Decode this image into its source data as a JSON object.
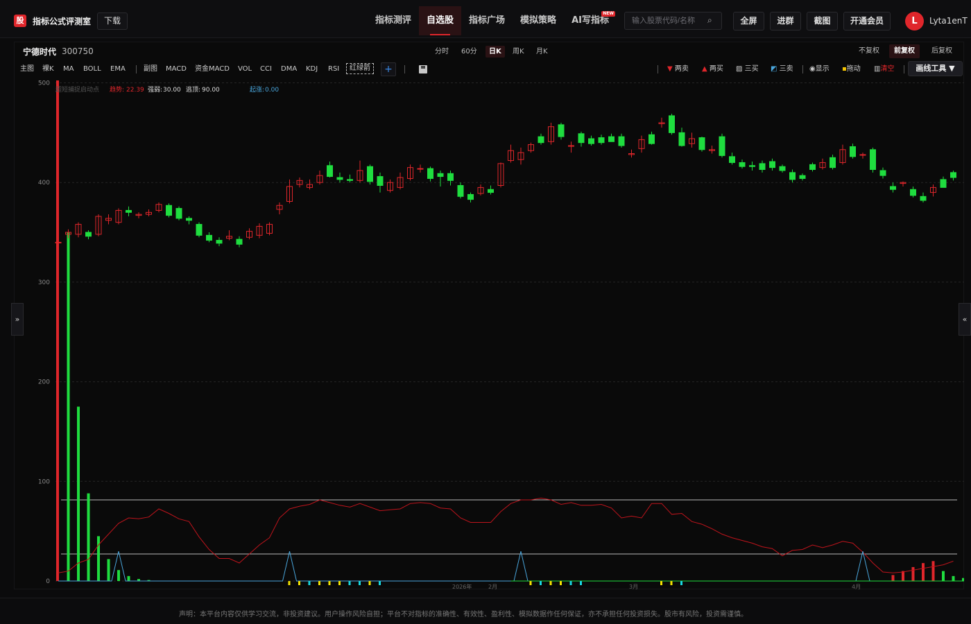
{
  "app": {
    "logo_char": "股",
    "title": "指标公式评测室",
    "download_label": "下载"
  },
  "nav": {
    "items": [
      {
        "label": "指标测评",
        "active": false
      },
      {
        "label": "自选股",
        "active": true
      },
      {
        "label": "指标广场",
        "active": false
      },
      {
        "label": "模拟策略",
        "active": false
      },
      {
        "label": "AI写指标",
        "active": false,
        "badge": "NEW"
      }
    ]
  },
  "search": {
    "placeholder": "输入股票代码/名称",
    "icon": "search-icon"
  },
  "toolbar_right": {
    "fullscreen": "全屏",
    "join_group": "进群",
    "screenshot": "截图",
    "membership": "开通会员"
  },
  "user": {
    "avatar_letter": "L",
    "name": "Lyta1enT"
  },
  "stock": {
    "name": "宁德时代",
    "code": "300750"
  },
  "periods": [
    "分时",
    "60分",
    "日K",
    "周K",
    "月K"
  ],
  "active_period": "日K",
  "adjust": [
    "不复权",
    "前复权",
    "后复权"
  ],
  "active_adjust": "前复权",
  "indicators_main": [
    "主图",
    "裸K",
    "MA",
    "BOLL",
    "EMA"
  ],
  "indicators_sub": [
    "副图",
    "MACD",
    "资金MACD",
    "VOL",
    "CCI",
    "DMA",
    "KDJ",
    "RSI"
  ],
  "indicator_active": "红绿箭",
  "tools": {
    "two_sell": "两卖",
    "two_buy": "两买",
    "three_buy": "三买",
    "three_sell": "三卖",
    "show": "显示",
    "drag": "拖动",
    "clear": "清空",
    "draw_tools": "画线工具 ▼"
  },
  "colors": {
    "up": "#e0262b",
    "down": "#1fdd3f",
    "accent": "#e0262b",
    "blue_line": "#4aa6dc",
    "yellow": "#f4e300",
    "cyan": "#18d8e0"
  },
  "overlay_legend": {
    "name": "超短捕捉启动点",
    "trend_label": "趋势:",
    "trend_value": "22.39",
    "weak_label": "强弱:",
    "weak_value": "30.00",
    "top_label": "逃顶:",
    "top_value": "90.00",
    "rise_label": "起涨:",
    "rise_value": "0.00"
  },
  "x_axis_labels": [
    "2026年",
    "2月",
    "3月",
    "4月"
  ],
  "footer_text": "声明：本平台内容仅供学习交流，非投资建议。用户操作风险自担；平台不对指标的准确性、有效性、盈利性、模拟数据作任何保证，亦不承担任何投资损失。股市有风险，投资需谨慎。",
  "chart_data": {
    "type": "candlestick",
    "y_ticks": [
      0,
      100,
      200,
      300,
      400,
      500
    ],
    "ylim": [
      0,
      500
    ],
    "candles": [
      [
        340,
        340,
        338,
        342
      ],
      [
        348,
        350,
        344,
        353
      ],
      [
        348,
        358,
        345,
        360
      ],
      [
        350,
        346,
        343,
        352
      ],
      [
        348,
        366,
        346,
        368
      ],
      [
        362,
        364,
        358,
        368
      ],
      [
        360,
        372,
        358,
        374
      ],
      [
        372,
        370,
        366,
        376
      ],
      [
        367,
        368,
        364,
        370
      ],
      [
        368,
        370,
        366,
        373
      ],
      [
        372,
        378,
        370,
        380
      ],
      [
        377,
        367,
        365,
        379
      ],
      [
        374,
        364,
        362,
        376
      ],
      [
        364,
        362,
        358,
        366
      ],
      [
        358,
        347,
        345,
        360
      ],
      [
        347,
        342,
        340,
        350
      ],
      [
        342,
        339,
        336,
        345
      ],
      [
        344,
        346,
        342,
        352
      ],
      [
        343,
        338,
        335,
        346
      ],
      [
        345,
        351,
        343,
        354
      ],
      [
        347,
        356,
        344,
        359
      ],
      [
        349,
        358,
        347,
        360
      ],
      [
        373,
        377,
        368,
        380
      ],
      [
        381,
        396,
        379,
        403
      ],
      [
        398,
        402,
        395,
        405
      ],
      [
        395,
        398,
        393,
        403
      ],
      [
        400,
        407,
        398,
        412
      ],
      [
        417,
        406,
        405,
        421
      ],
      [
        405,
        403,
        400,
        410
      ],
      [
        403,
        402,
        400,
        408
      ],
      [
        402,
        412,
        400,
        422
      ],
      [
        416,
        401,
        398,
        418
      ],
      [
        406,
        397,
        390,
        410
      ],
      [
        392,
        400,
        390,
        403
      ],
      [
        395,
        405,
        393,
        410
      ],
      [
        404,
        415,
        402,
        418
      ],
      [
        414,
        414,
        410,
        418
      ],
      [
        414,
        404,
        401,
        416
      ],
      [
        409,
        406,
        396,
        412
      ],
      [
        409,
        402,
        397,
        412
      ],
      [
        397,
        386,
        384,
        400
      ],
      [
        388,
        383,
        380,
        390
      ],
      [
        389,
        395,
        387,
        398
      ],
      [
        393,
        390,
        388,
        397
      ],
      [
        397,
        419,
        395,
        420
      ],
      [
        422,
        432,
        420,
        438
      ],
      [
        423,
        430,
        418,
        435
      ],
      [
        432,
        438,
        430,
        440
      ],
      [
        446,
        440,
        438,
        449
      ],
      [
        441,
        456,
        438,
        460
      ],
      [
        458,
        446,
        443,
        460
      ],
      [
        437,
        437,
        430,
        441
      ],
      [
        449,
        440,
        436,
        451
      ],
      [
        444,
        439,
        437,
        447
      ],
      [
        445,
        440,
        438,
        448
      ],
      [
        446,
        441,
        442,
        449
      ],
      [
        446,
        437,
        435,
        449
      ],
      [
        428,
        429,
        425,
        433
      ],
      [
        434,
        443,
        430,
        447
      ],
      [
        448,
        439,
        438,
        451
      ],
      [
        459,
        460,
        455,
        465
      ],
      [
        467,
        450,
        448,
        469
      ],
      [
        450,
        437,
        436,
        455
      ],
      [
        439,
        444,
        435,
        450
      ],
      [
        445,
        433,
        431,
        446
      ],
      [
        432,
        433,
        429,
        437
      ],
      [
        446,
        427,
        425,
        449
      ],
      [
        426,
        420,
        418,
        430
      ],
      [
        420,
        416,
        414,
        423
      ],
      [
        417,
        416,
        412,
        421
      ],
      [
        419,
        413,
        410,
        422
      ],
      [
        421,
        415,
        412,
        424
      ],
      [
        416,
        412,
        410,
        418
      ],
      [
        410,
        403,
        400,
        413
      ],
      [
        407,
        404,
        402,
        409
      ],
      [
        418,
        413,
        411,
        420
      ],
      [
        415,
        420,
        413,
        424
      ],
      [
        425,
        415,
        413,
        428
      ],
      [
        420,
        433,
        418,
        438
      ],
      [
        436,
        426,
        424,
        439
      ],
      [
        428,
        428,
        424,
        430
      ],
      [
        433,
        413,
        410,
        435
      ],
      [
        412,
        407,
        404,
        415
      ],
      [
        396,
        393,
        390,
        400
      ],
      [
        399,
        400,
        396,
        401
      ],
      [
        393,
        387,
        385,
        396
      ],
      [
        386,
        382,
        380,
        390
      ],
      [
        390,
        395,
        386,
        398
      ],
      [
        403,
        395,
        396,
        406
      ],
      [
        410,
        405,
        402,
        412
      ]
    ],
    "volume_bars": [
      {
        "i": 1,
        "v": 350,
        "c": "green"
      },
      {
        "i": 2,
        "v": 175,
        "c": "green"
      },
      {
        "i": 3,
        "v": 88,
        "c": "green"
      },
      {
        "i": 4,
        "v": 45,
        "c": "green"
      },
      {
        "i": 5,
        "v": 22,
        "c": "green"
      },
      {
        "i": 6,
        "v": 11,
        "c": "green"
      },
      {
        "i": 7,
        "v": 5,
        "c": "green"
      },
      {
        "i": 8,
        "v": 2,
        "c": "green"
      },
      {
        "i": 9,
        "v": 1,
        "c": "green"
      },
      {
        "i": 83,
        "v": 6,
        "c": "red"
      },
      {
        "i": 84,
        "v": 10,
        "c": "red"
      },
      {
        "i": 85,
        "v": 14,
        "c": "red"
      },
      {
        "i": 86,
        "v": 18,
        "c": "red"
      },
      {
        "i": 87,
        "v": 20,
        "c": "red"
      },
      {
        "i": 88,
        "v": 10,
        "c": "green"
      },
      {
        "i": 89,
        "v": 5,
        "c": "green"
      },
      {
        "i": 90,
        "v": 3,
        "c": "green"
      }
    ],
    "red_line": [
      9,
      11,
      20,
      24,
      40,
      52,
      64,
      70,
      69,
      71,
      80,
      75,
      69,
      66,
      49,
      35,
      25,
      25,
      20,
      30,
      40,
      48,
      70,
      80,
      83,
      85,
      90,
      87,
      84,
      82,
      86,
      82,
      78,
      79,
      80,
      86,
      87,
      86,
      81,
      80,
      70,
      65,
      65,
      65,
      77,
      86,
      90,
      90,
      92,
      90,
      85,
      87,
      84,
      84,
      85,
      81,
      70,
      72,
      70,
      86,
      86,
      74,
      75,
      66,
      63,
      58,
      52,
      48,
      45,
      42,
      38,
      36,
      28,
      34,
      35,
      40,
      37,
      40,
      44,
      42,
      32,
      20,
      10,
      9,
      10,
      12,
      14,
      16,
      18,
      22
    ],
    "blue_line_spikes": [
      6,
      23,
      46,
      80
    ],
    "h_lines": [
      90,
      30
    ],
    "marks": [
      {
        "i": 23,
        "c": "yellow"
      },
      {
        "i": 24,
        "c": "yellow"
      },
      {
        "i": 25,
        "c": "cyan"
      },
      {
        "i": 26,
        "c": "yellow"
      },
      {
        "i": 27,
        "c": "yellow"
      },
      {
        "i": 28,
        "c": "yellow"
      },
      {
        "i": 29,
        "c": "cyan"
      },
      {
        "i": 30,
        "c": "cyan"
      },
      {
        "i": 31,
        "c": "yellow"
      },
      {
        "i": 32,
        "c": "cyan"
      },
      {
        "i": 47,
        "c": "yellow"
      },
      {
        "i": 48,
        "c": "cyan"
      },
      {
        "i": 49,
        "c": "yellow"
      },
      {
        "i": 50,
        "c": "yellow"
      },
      {
        "i": 51,
        "c": "cyan"
      },
      {
        "i": 52,
        "c": "cyan"
      },
      {
        "i": 60,
        "c": "yellow"
      },
      {
        "i": 61,
        "c": "yellow"
      },
      {
        "i": 62,
        "c": "cyan"
      }
    ]
  }
}
